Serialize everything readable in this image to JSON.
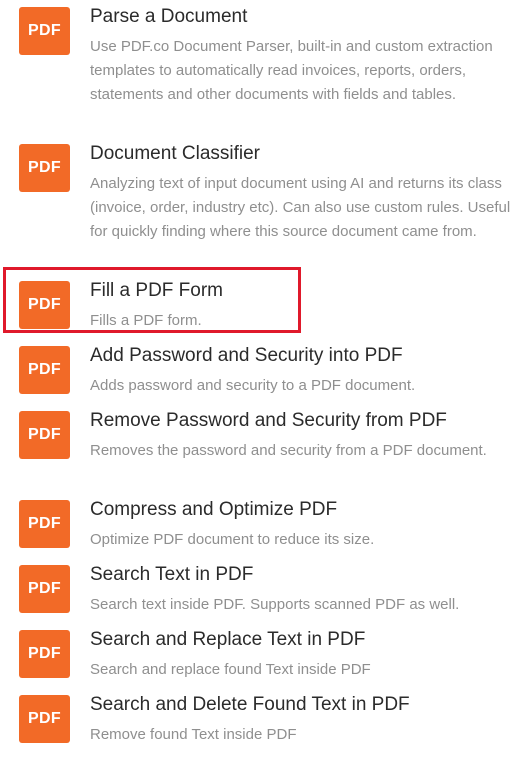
{
  "items": [
    {
      "badge": "PDF",
      "title": "Parse a Document",
      "description": "Use PDF.co Document Parser, built-in and custom extraction templates to automatically read invoices, reports, orders, statements and other documents with fields and tables."
    },
    {
      "badge": "PDF",
      "title": "Document Classifier",
      "description": "Analyzing text of input document using AI and returns its class (invoice, order, industry etc). Can also use custom rules. Useful for quickly finding where this source document came from."
    },
    {
      "badge": "PDF",
      "title": "Fill a PDF Form",
      "description": "Fills a PDF form."
    },
    {
      "badge": "PDF",
      "title": "Add Password and Security into PDF",
      "description": "Adds password and security to a PDF document."
    },
    {
      "badge": "PDF",
      "title": "Remove Password and Security from PDF",
      "description": "Removes the password and security from a PDF document."
    },
    {
      "badge": "PDF",
      "title": "Compress and Optimize PDF",
      "description": "Optimize PDF document to reduce its size."
    },
    {
      "badge": "PDF",
      "title": "Search Text in PDF",
      "description": "Search text inside PDF. Supports scanned PDF as well."
    },
    {
      "badge": "PDF",
      "title": "Search and Replace Text in PDF",
      "description": "Search and replace found Text inside PDF"
    },
    {
      "badge": "PDF",
      "title": "Search and Delete Found Text in PDF",
      "description": "Remove found Text inside PDF"
    }
  ],
  "colors": {
    "badge_background": "#f26a27",
    "title_text": "#2b2b2b",
    "description_text": "#8f8f8f",
    "highlight_border": "#e0192b"
  }
}
